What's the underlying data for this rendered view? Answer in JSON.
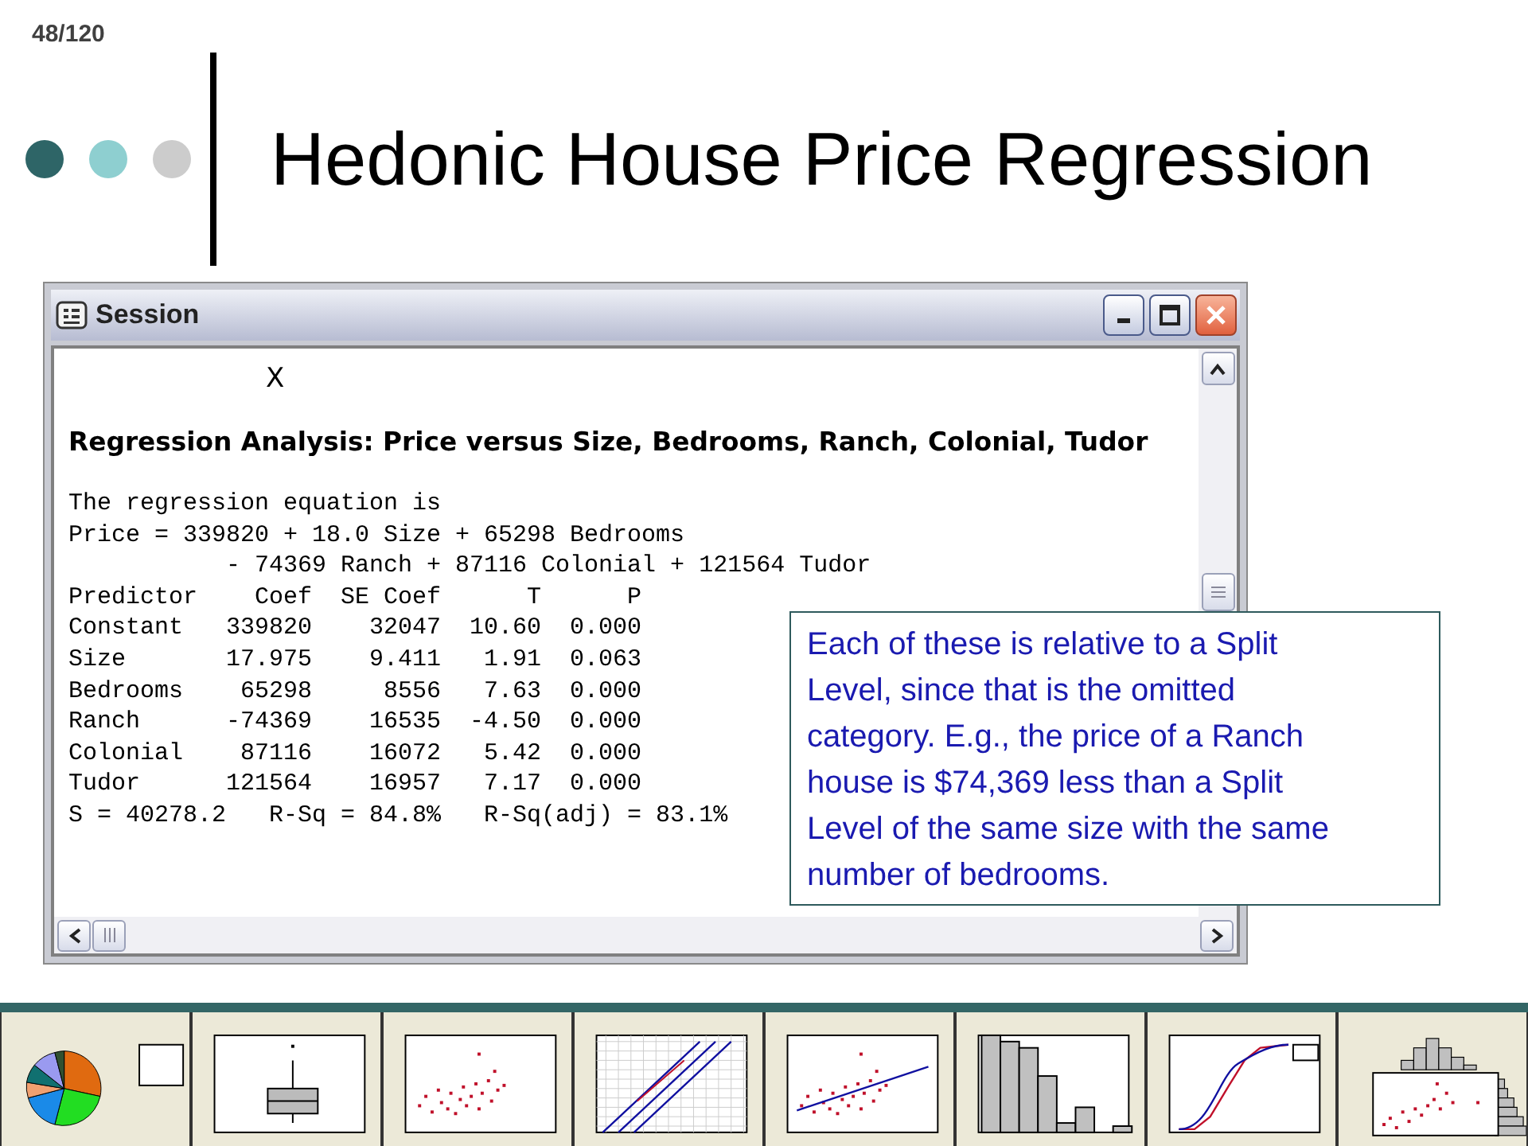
{
  "slide_number": "48/120",
  "title": "Hedonic House Price Regression",
  "session_window": {
    "title": "Session",
    "marker": "X",
    "heading": "Regression Analysis: Price versus Size, Bedrooms, Ranch, Colonial, Tudor",
    "lines": [
      "The regression equation is",
      "Price = 339820 + 18.0 Size + 65298 Bedrooms",
      "           - 74369 Ranch + 87116 Colonial + 121564 Tudor",
      "Predictor    Coef  SE Coef      T      P",
      "Constant   339820    32047  10.60  0.000",
      "Size       17.975    9.411   1.91  0.063",
      "Bedrooms    65298     8556   7.63  0.000",
      "Ranch      -74369    16535  -4.50  0.000",
      "Colonial    87116    16072   5.42  0.000",
      "Tudor      121564    16957   7.17  0.000",
      "S = 40278.2   R-Sq = 84.8%   R-Sq(adj) = 83.1%"
    ]
  },
  "callout": "Each of these is relative to a Split Level, since that is the omitted category. E.g., the price of a Ranch house is $74,369 less than a Split Level of the same size with the same number of bedrooms.",
  "thumbnails": [
    {
      "kind": "pie"
    },
    {
      "kind": "boxplot"
    },
    {
      "kind": "scatter"
    },
    {
      "kind": "probability"
    },
    {
      "kind": "scatter_fit"
    },
    {
      "kind": "histogram"
    },
    {
      "kind": "ecdf"
    },
    {
      "kind": "marginal"
    }
  ]
}
